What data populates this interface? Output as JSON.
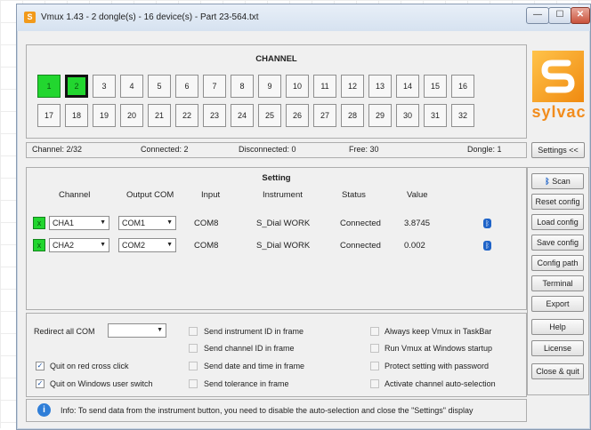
{
  "window": {
    "title": "Vmux 1.43 - 2 dongle(s) - 16 device(s) - Part 23-564.txt",
    "app_icon": "S"
  },
  "title_buttons": {
    "minimize": "—",
    "maximize": "☐",
    "close": "✕"
  },
  "channel_panel": {
    "title": "CHANNEL",
    "row1": [
      {
        "label": "1",
        "state": "on"
      },
      {
        "label": "2",
        "state": "selected"
      },
      {
        "label": "3"
      },
      {
        "label": "4"
      },
      {
        "label": "5"
      },
      {
        "label": "6"
      },
      {
        "label": "7"
      },
      {
        "label": "8"
      },
      {
        "label": "9"
      },
      {
        "label": "10"
      },
      {
        "label": "11"
      },
      {
        "label": "12"
      },
      {
        "label": "13"
      },
      {
        "label": "14"
      },
      {
        "label": "15"
      },
      {
        "label": "16"
      }
    ],
    "row2": [
      {
        "label": "17"
      },
      {
        "label": "18"
      },
      {
        "label": "19"
      },
      {
        "label": "20"
      },
      {
        "label": "21"
      },
      {
        "label": "22"
      },
      {
        "label": "23"
      },
      {
        "label": "24"
      },
      {
        "label": "25"
      },
      {
        "label": "26"
      },
      {
        "label": "27"
      },
      {
        "label": "28"
      },
      {
        "label": "29"
      },
      {
        "label": "30"
      },
      {
        "label": "31"
      },
      {
        "label": "32"
      }
    ]
  },
  "logo": {
    "text": "sylvac",
    "color": "#f28c1c"
  },
  "status": {
    "channel": "Channel: 2/32",
    "connected": "Connected: 2",
    "disconnected": "Disconnected: 0",
    "free": "Free: 30",
    "dongle": "Dongle: 1"
  },
  "setting": {
    "title": "Setting",
    "headers": {
      "channel": "Channel",
      "output_com": "Output COM",
      "input": "Input",
      "instrument": "Instrument",
      "status": "Status",
      "value": "Value"
    },
    "rows": [
      {
        "check": "x",
        "channel": "CHA1",
        "output_com": "COM1",
        "input": "COM8",
        "instrument": "S_Dial WORK",
        "status": "Connected",
        "value": "3.8745",
        "icon": "bluetooth-icon"
      },
      {
        "check": "x",
        "channel": "CHA2",
        "output_com": "COM2",
        "input": "COM8",
        "instrument": "S_Dial WORK",
        "status": "Connected",
        "value": "0.002",
        "icon": "bluetooth-icon"
      }
    ]
  },
  "options": {
    "redirect_label": "Redirect all COM",
    "redirect_value": "",
    "quit_red_cross": {
      "label": "Quit on red cross click",
      "checked": true
    },
    "quit_user_switch": {
      "label": "Quit on Windows user switch",
      "checked": true
    },
    "send_id": {
      "label": "Send instrument ID in frame",
      "checked": false
    },
    "send_channel_id": {
      "label": "Send channel ID in frame",
      "checked": false
    },
    "send_datetime": {
      "label": "Send date and time in frame",
      "checked": false
    },
    "send_tolerance": {
      "label": "Send tolerance in frame",
      "checked": false
    },
    "keep_taskbar": {
      "label": "Always keep Vmux in TaskBar",
      "checked": false
    },
    "run_startup": {
      "label": "Run Vmux at Windows startup",
      "checked": false
    },
    "protect_password": {
      "label": "Protect setting with password",
      "checked": false
    },
    "auto_selection": {
      "label": "Activate channel auto-selection",
      "checked": false
    }
  },
  "info": {
    "icon": "i",
    "text": "Info: To send data from the instrument button, you need to disable the auto-selection and close the \"Settings\" display"
  },
  "sidebar": {
    "settings_toggle": "Settings <<",
    "scan": "Scan",
    "reset_config": "Reset config",
    "load_config": "Load config",
    "save_config": "Save config",
    "config_path": "Config path",
    "terminal": "Terminal",
    "export": "Export",
    "help": "Help",
    "license": "License",
    "close_quit": "Close & quit"
  }
}
